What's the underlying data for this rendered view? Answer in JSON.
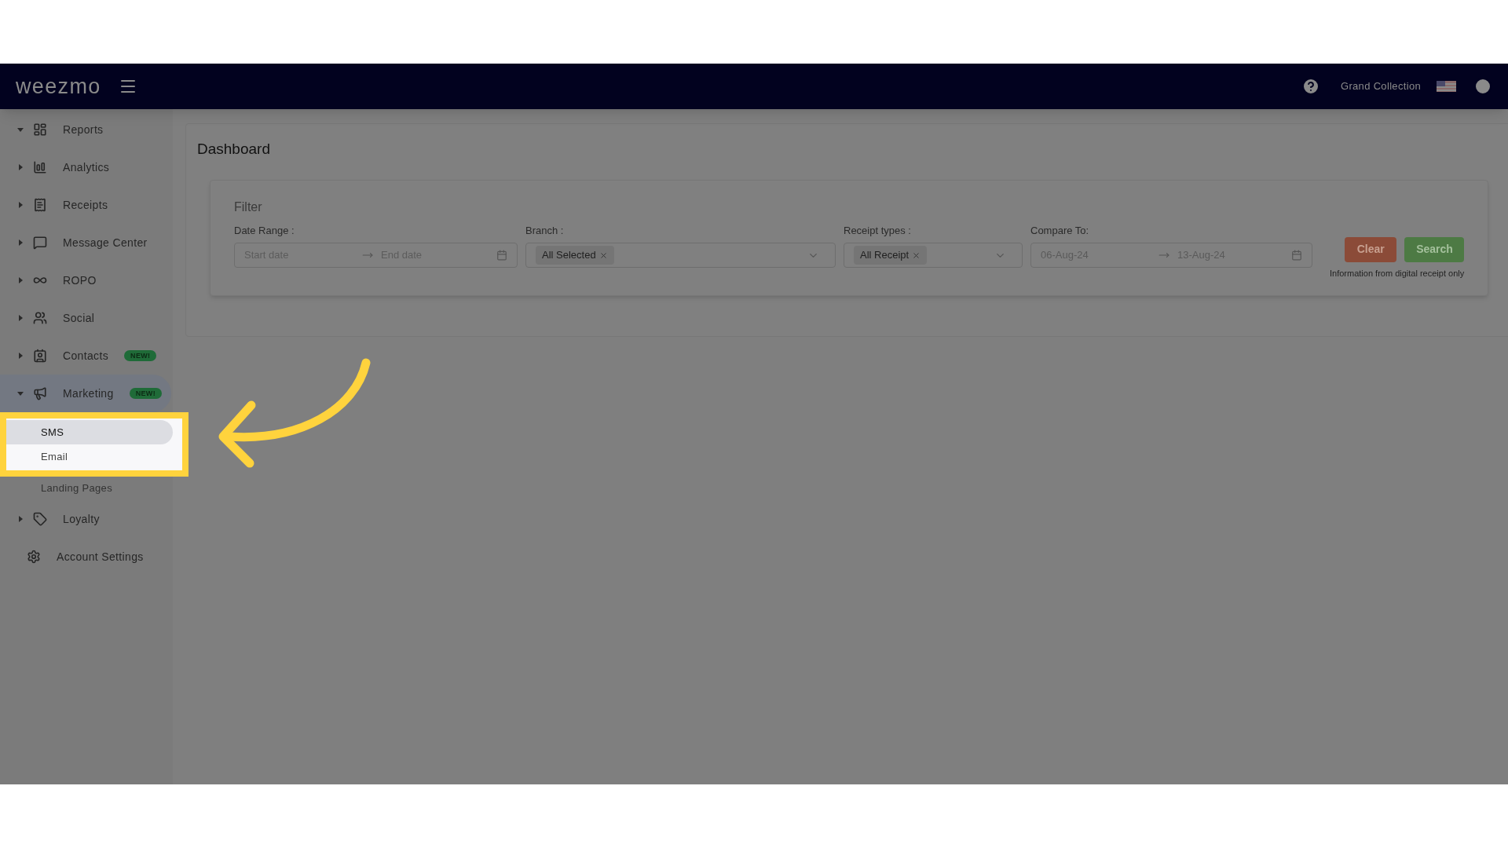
{
  "header": {
    "logo": "weezmo",
    "organization": "Grand Collection"
  },
  "sidebar": {
    "items": [
      {
        "label": "Reports",
        "expanded": true
      },
      {
        "label": "Analytics",
        "expanded": false
      },
      {
        "label": "Receipts",
        "expanded": false
      },
      {
        "label": "Message Center",
        "expanded": false
      },
      {
        "label": "ROPO",
        "expanded": false
      },
      {
        "label": "Social",
        "expanded": false
      },
      {
        "label": "Contacts",
        "expanded": false,
        "badge": "NEW!"
      },
      {
        "label": "Marketing",
        "expanded": true,
        "badge": "NEW!",
        "children": [
          {
            "label": "SMS",
            "selected": true
          },
          {
            "label": "Email",
            "selected": false
          },
          {
            "label": "Landing Pages",
            "selected": false
          }
        ]
      },
      {
        "label": "Loyalty",
        "expanded": false
      },
      {
        "label": "Account Settings"
      }
    ]
  },
  "page": {
    "title": "Dashboard"
  },
  "filter": {
    "title": "Filter",
    "date_range": {
      "label": "Date Range :",
      "start_placeholder": "Start date",
      "end_placeholder": "End date"
    },
    "branch": {
      "label": "Branch :",
      "tag": "All Selected"
    },
    "receipt_types": {
      "label": "Receipt types :",
      "tag": "All Receipt"
    },
    "compare_to": {
      "label": "Compare To:",
      "start": "06-Aug-24",
      "end": "13-Aug-24"
    },
    "buttons": [
      "Clear",
      "Search"
    ],
    "note": "Information from digital receipt only"
  }
}
